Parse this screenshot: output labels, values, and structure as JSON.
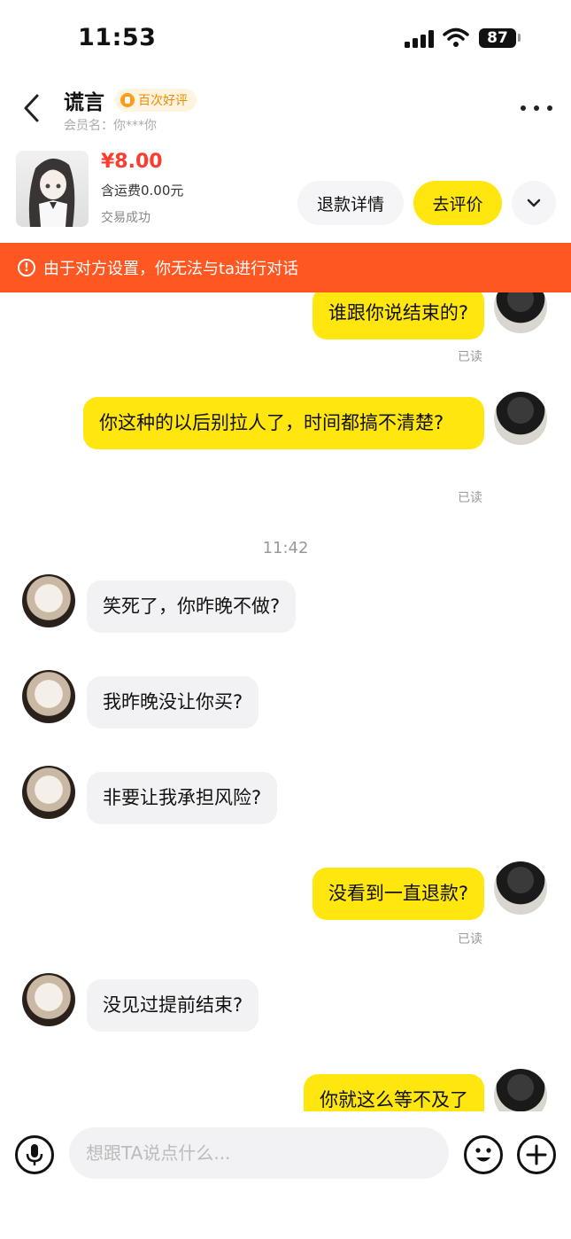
{
  "status_bar": {
    "time": "11:53",
    "battery": "87"
  },
  "header": {
    "title": "谎言",
    "badge": "百次好评",
    "member_label": "会员名：你***你"
  },
  "order": {
    "price": "¥8.00",
    "shipping": "含运费0.00元",
    "status": "交易成功",
    "refund_label": "退款详情",
    "review_label": "去评价"
  },
  "warning": {
    "text": "由于对方设置，你无法与ta进行对话"
  },
  "chat": {
    "read_label": "已读",
    "time_divider": "11:42",
    "messages": [
      {
        "side": "out",
        "text": "谁跟你说结束的?"
      },
      {
        "side": "out",
        "text": "你这种的以后别拉人了，时间都搞不清楚?"
      },
      {
        "side": "in",
        "text": "笑死了，你昨晚不做?"
      },
      {
        "side": "in",
        "text": "我昨晚没让你买?"
      },
      {
        "side": "in",
        "text": "非要让我承担风险?"
      },
      {
        "side": "out",
        "text": "没看到一直退款?"
      },
      {
        "side": "in",
        "text": "没见过提前结束?"
      },
      {
        "side": "out",
        "text": "你就这么等不及了"
      }
    ]
  },
  "input": {
    "placeholder": "想跟TA说点什么..."
  },
  "colors": {
    "accent": "#ffe60f",
    "warning": "#ff5722",
    "price": "#ff3b30"
  }
}
